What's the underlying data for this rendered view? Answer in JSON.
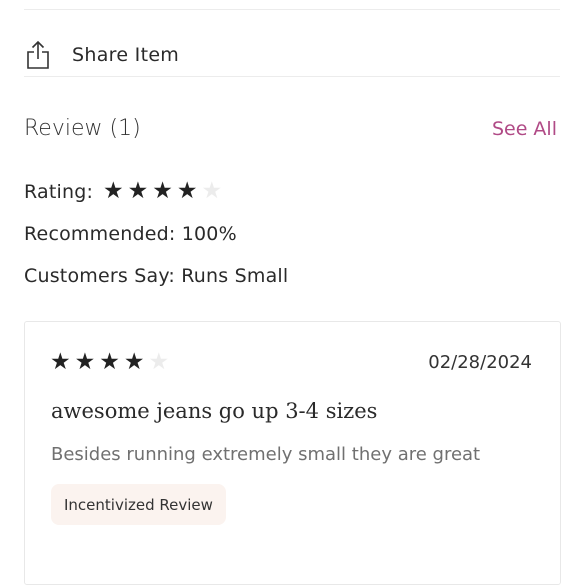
{
  "share": {
    "label": "Share Item",
    "icon": "share-icon"
  },
  "review_section": {
    "title": "Review (1)",
    "see_all": "See All",
    "rating_label": "Rating:",
    "rating_value": 4,
    "rating_max": 5,
    "recommended": "Recommended: 100%",
    "customers_say": "Customers Say: Runs Small"
  },
  "review": {
    "rating_value": 4,
    "rating_max": 5,
    "date": "02/28/2024",
    "title": "awesome jeans go up 3-4 sizes",
    "body": "Besides running extremely small they are great",
    "badge": "Incentivized Review"
  },
  "colors": {
    "accent": "#b04a86",
    "badge_bg": "#fbf3ef",
    "star_filled": "#222222",
    "star_empty": "#ececec"
  }
}
